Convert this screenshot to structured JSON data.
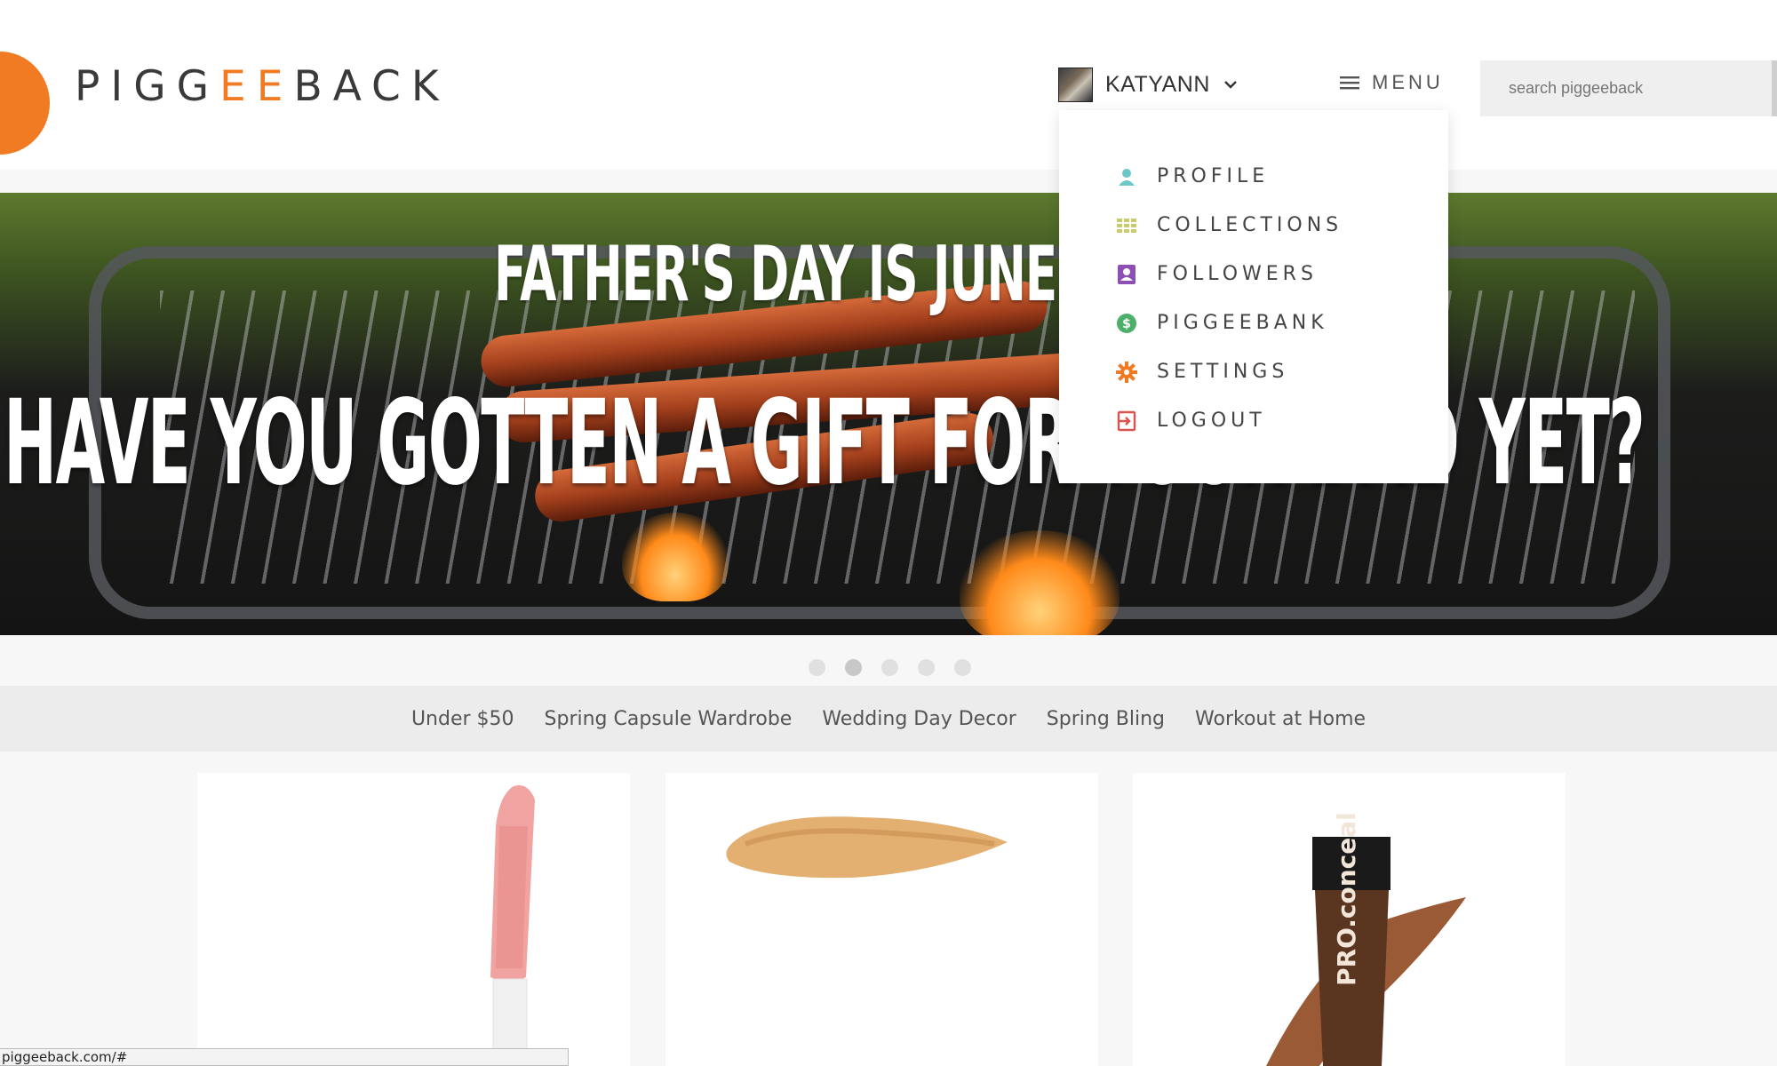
{
  "brand": {
    "pre": "PIGG",
    "ee": "EE",
    "post": "BACK",
    "accent_color": "#f07b23"
  },
  "header": {
    "user_name": "KATYANN",
    "menu_label": "MENU",
    "search_placeholder": "search piggeeback"
  },
  "banner": {
    "line1": "FATHER'S DAY IS JUNE 19TH",
    "line2": "HAVE YOU GOTTEN A GIFT FOR YOUR DAD YET?"
  },
  "carousel": {
    "count": 5,
    "active_index": 1
  },
  "categories": [
    "Under $50",
    "Spring Capsule Wardrobe",
    "Wedding Day Decor",
    "Spring Bling",
    "Workout at Home"
  ],
  "dropdown": {
    "items": [
      {
        "label": "PROFILE",
        "icon": "user-icon",
        "color": "#6cc7c7"
      },
      {
        "label": "COLLECTIONS",
        "icon": "grid-icon",
        "color": "#c9cc6a"
      },
      {
        "label": "FOLLOWERS",
        "icon": "contact-card-icon",
        "color": "#8e4fb5"
      },
      {
        "label": "PIGGEEBANK",
        "icon": "dollar-coin-icon",
        "color": "#4caf6a"
      },
      {
        "label": "SETTINGS",
        "icon": "gear-icon",
        "color": "#f07b23"
      },
      {
        "label": "LOGOUT",
        "icon": "logout-icon",
        "color": "#d9534f"
      }
    ]
  },
  "products": [
    {
      "image": "lip-gloss-wand"
    },
    {
      "image": "foundation-swatch"
    },
    {
      "image": "concealer-tube",
      "tube_text": "PRO.conceal"
    }
  ],
  "status_url": "piggeeback.com/#"
}
